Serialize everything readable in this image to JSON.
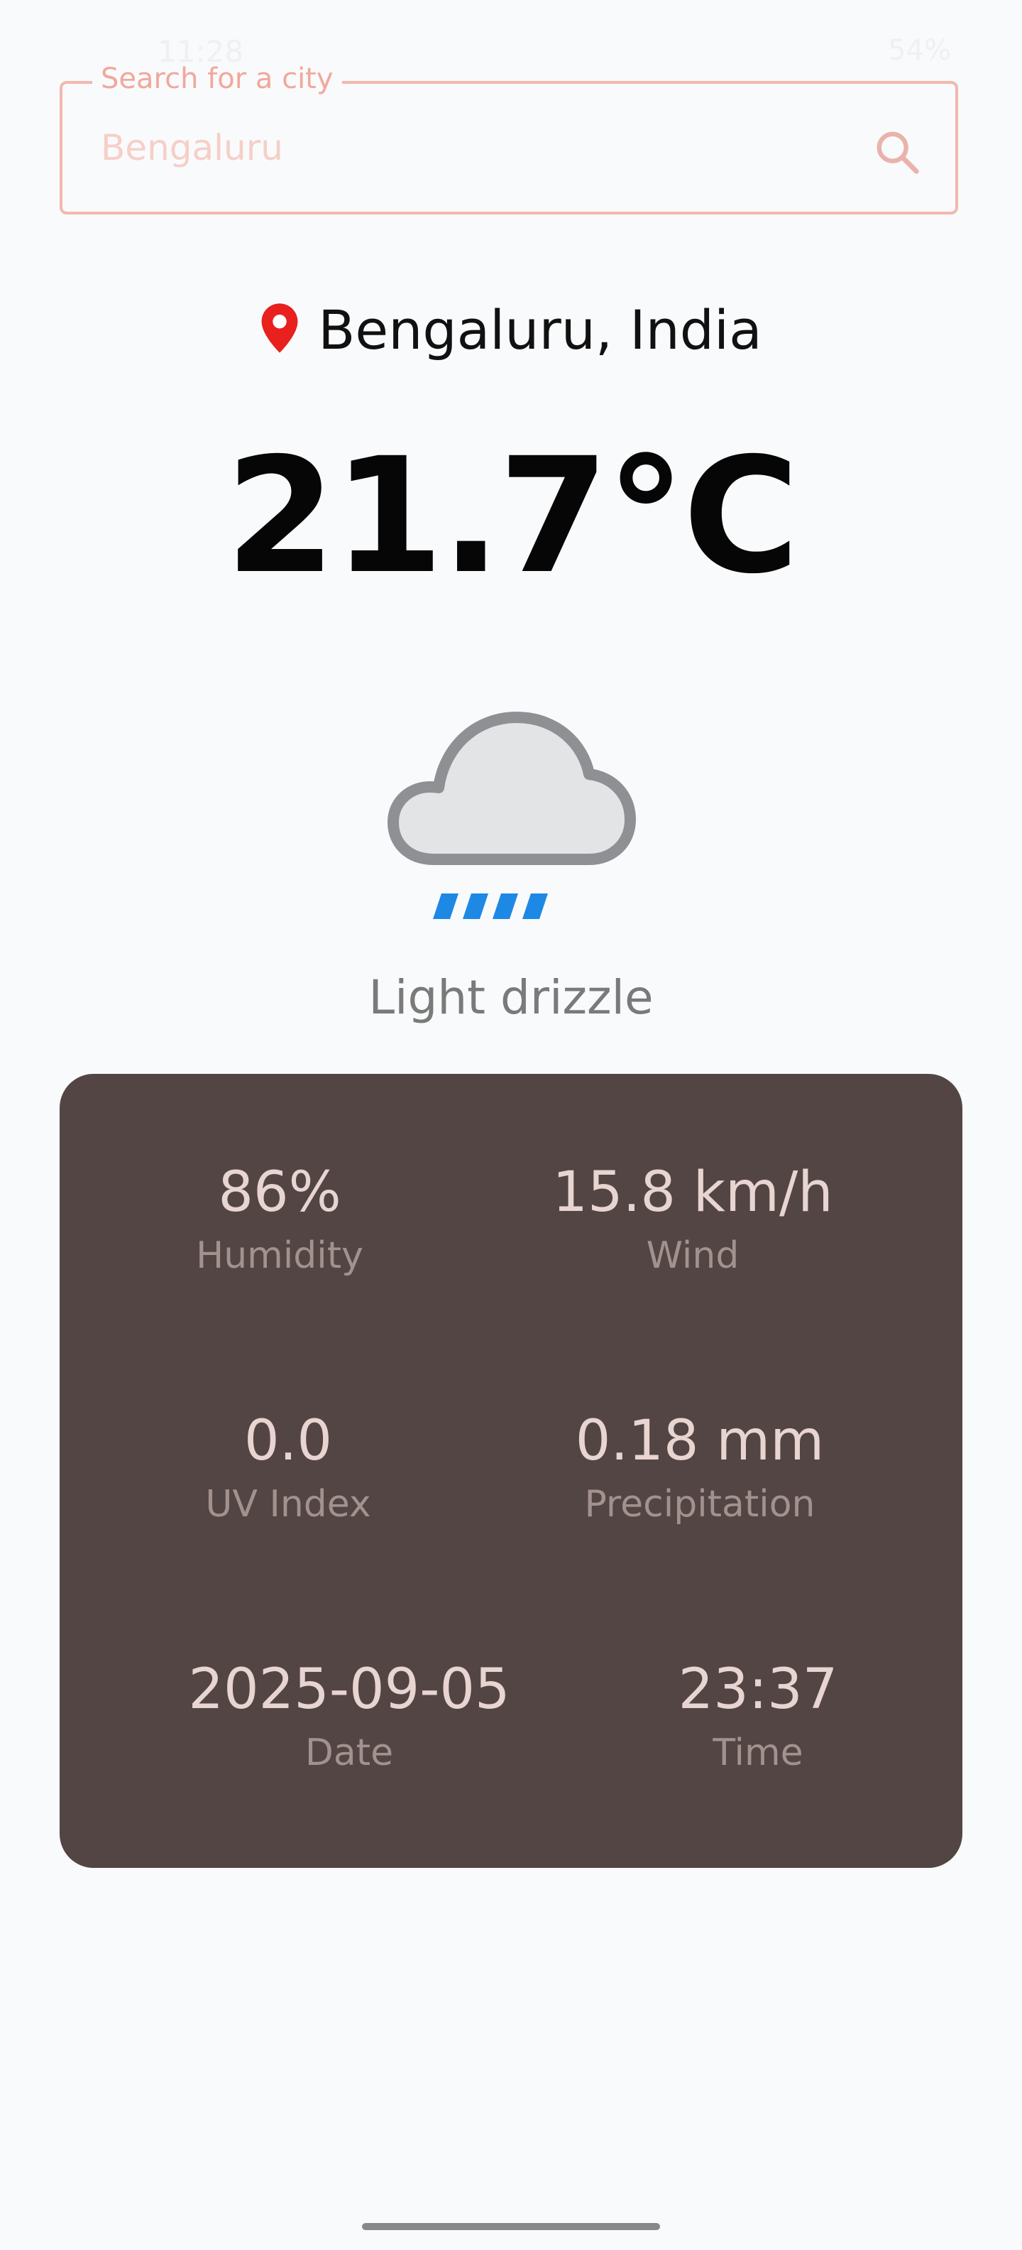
{
  "status_bar": {
    "time": "11:28",
    "battery": "54%"
  },
  "search": {
    "label": "Search for a city",
    "placeholder": "Bengaluru",
    "value": ""
  },
  "location": {
    "name": "Bengaluru, India"
  },
  "current": {
    "temperature": "21.7°C",
    "condition": "Light drizzle",
    "icon": "light-drizzle-cloud-icon"
  },
  "stats": [
    {
      "value": "86%",
      "label": "Humidity"
    },
    {
      "value": "15.8 km/h",
      "label": "Wind"
    },
    {
      "value": "0.0",
      "label": "UV Index"
    },
    {
      "value": "0.18 mm",
      "label": "Precipitation"
    },
    {
      "value": "2025-09-05",
      "label": "Date"
    },
    {
      "value": "23:37",
      "label": "Time"
    }
  ],
  "colors": {
    "background": "#f9fafb",
    "accent": "#f3b7ae",
    "card": "#524544",
    "pin": "#e8201e",
    "drizzle": "#1e88e5"
  }
}
